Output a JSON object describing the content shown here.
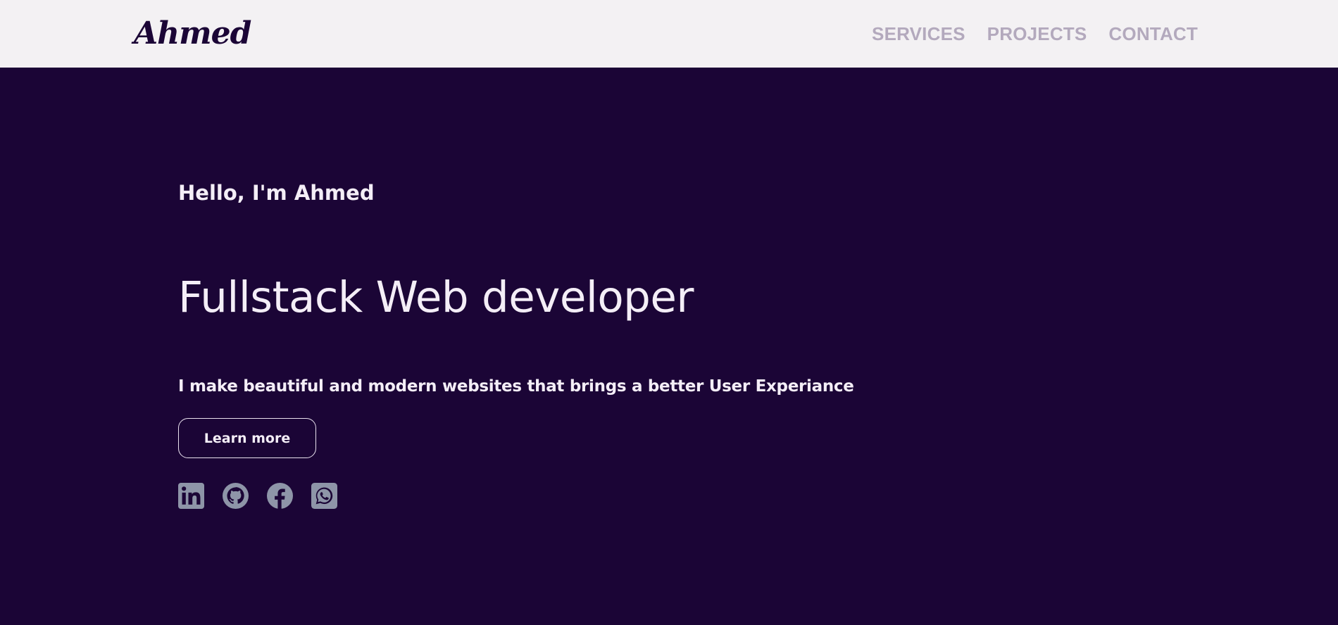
{
  "header": {
    "logo": "Ahmed",
    "nav": [
      "SERVICES",
      "PROJECTS",
      "CONTACT"
    ]
  },
  "hero": {
    "greeting": "Hello, I'm Ahmed",
    "headline": "Fullstack Web developer",
    "tagline": "I make beautiful and modern websites that brings a better User Experiance",
    "cta_label": "Learn more"
  },
  "socials": [
    "linkedin-icon",
    "github-icon",
    "facebook-icon",
    "whatsapp-icon"
  ],
  "colors": {
    "background": "#1b0536",
    "header_bg": "#f3f1f3",
    "nav_text": "#b3a9bd",
    "text": "#f4eef7",
    "icon": "#8e95a8"
  }
}
